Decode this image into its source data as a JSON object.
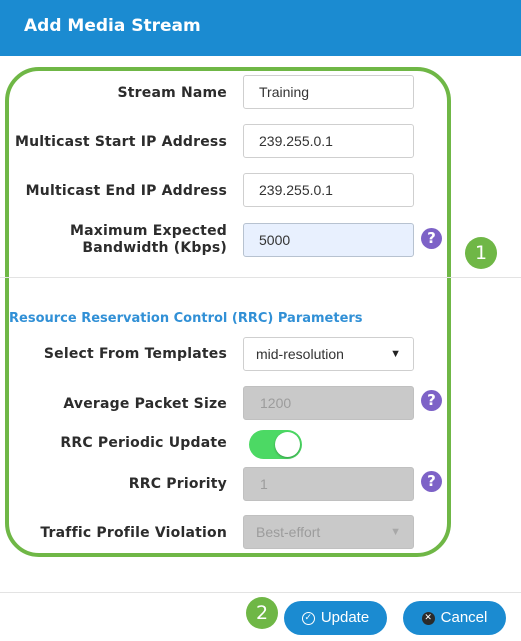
{
  "dialog": {
    "title": "Add Media Stream"
  },
  "form": {
    "stream_name": {
      "label": "Stream Name",
      "value": "Training"
    },
    "start_ip": {
      "label": "Multicast Start IP Address",
      "value": "239.255.0.1"
    },
    "end_ip": {
      "label": "Multicast End IP Address",
      "value": "239.255.0.1"
    },
    "bandwidth": {
      "label_line1": "Maximum Expected",
      "label_line2": "Bandwidth (Kbps)",
      "value": "5000"
    }
  },
  "rrc": {
    "section_title": "Resource Reservation Control (RRC) Parameters",
    "template": {
      "label": "Select From Templates",
      "value": "mid-resolution"
    },
    "packet_size": {
      "label": "Average Packet Size",
      "value": "1200"
    },
    "periodic_update": {
      "label": "RRC Periodic Update",
      "enabled": true
    },
    "priority": {
      "label": "RRC Priority",
      "value": "1"
    },
    "violation": {
      "label": "Traffic Profile Violation",
      "value": "Best-effort"
    }
  },
  "callouts": {
    "one": "1",
    "two": "2"
  },
  "buttons": {
    "update": "Update",
    "cancel": "Cancel"
  },
  "icons": {
    "help": "question-circle-icon",
    "caret": "caret-down-icon",
    "update": "check-circle-icon",
    "cancel": "close-circle-icon"
  },
  "colors": {
    "header": "#1b8bd1",
    "highlight": "#6fb746",
    "toggle_on": "#4cd964",
    "help": "#7d62c7",
    "section": "#3190d6"
  }
}
